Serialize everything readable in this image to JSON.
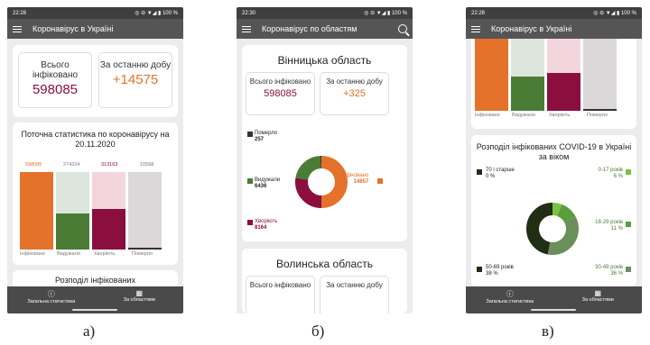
{
  "colors": {
    "infected": "#e4722a",
    "recovered": "#4a7c35",
    "dead": "#8a0f3e",
    "dark": "#333333",
    "light_recovered": "#dce5dc",
    "light_dead": "#f3d6dd",
    "light_total": "#dcd8da"
  },
  "phone_a": {
    "status_time": "22:28",
    "status_right": "◎ ⊖ ▼◢ ▮ 100 %",
    "title": "Коронавірус в Україні",
    "total_label": "Всього інфіковано",
    "total_value": "598085",
    "day_label": "За останню добу",
    "day_value": "+14575",
    "stats_title": "Поточна статистика по коронавірусу на 20.11.2020",
    "bar_values": [
      "598085",
      "274324",
      "313163",
      "10598"
    ],
    "bar_levels": {
      "infected": 1.0,
      "recovered": 0.46,
      "active": 0.52,
      "dead": 0.018
    },
    "bar_labels": [
      "Інфіковано",
      "Видужали",
      "Хворіють",
      "Померло"
    ],
    "next_card": "Розподіл інфікованих",
    "nav_left": "Загальна статистика",
    "nav_right": "За областями",
    "nav_left_icon": "info-icon",
    "nav_right_icon": "table-icon"
  },
  "phone_b": {
    "status_time": "22:30",
    "status_right": "◎ ⊖ ▼◢ ▮ 100 %",
    "title": "Коронавірус по областям",
    "region1": "Вінницька область",
    "total_label": "Всього інфіковано",
    "total_value": "598085",
    "day_label": "За останню добу",
    "day_value": "+325",
    "legend_dead": "Померло",
    "legend_dead_value": "257",
    "legend_rec": "Видужали",
    "legend_rec_value": "6436",
    "legend_inf": "Інфіковано",
    "legend_inf_value": "14857",
    "legend_sick": "Хворіють",
    "legend_sick_value": "8164",
    "region2": "Волинська область",
    "r2_total_label": "Всього інфіковано",
    "r2_day_label": "За останню добу"
  },
  "phone_c": {
    "status_time": "22:28",
    "status_right": "◎ ⊖ ▼◢ ▮ 100 %",
    "title": "Коронавірус в Україні",
    "bar_labels": [
      "Інфіковано",
      "Видужали",
      "Хворіють",
      "Померло"
    ],
    "age_title": "Розподіл інфікованих COVID-19 в Україні за віком",
    "age_70": "70 і старше",
    "age_70_v": "0 %",
    "age_0": "0-17 років",
    "age_0_v": "6 %",
    "age_18": "18-29 років",
    "age_18_v": "11 %",
    "age_50": "50-69 років",
    "age_50_v": "38 %",
    "age_30": "30-49 років",
    "age_30_v": "36 %",
    "nav_left": "Загальна статистика",
    "nav_right": "За областями"
  },
  "captions": [
    "а)",
    "б)",
    "в)"
  ]
}
